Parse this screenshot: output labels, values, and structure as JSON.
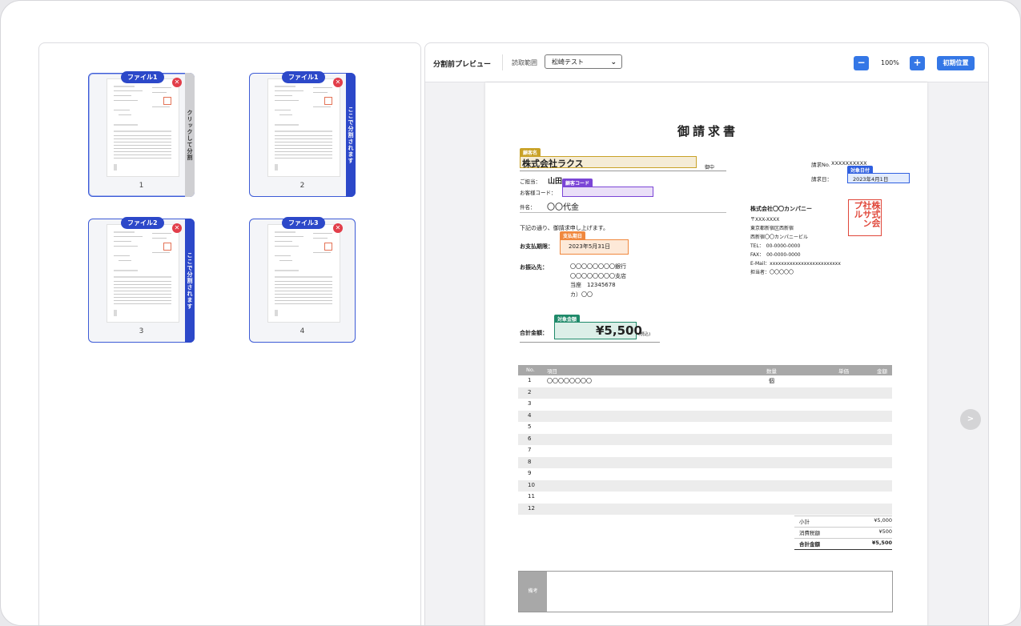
{
  "thumbnails": [
    {
      "file_label": "ファイル1",
      "page": "1",
      "side_text": "クリックして分割",
      "side_style": "gray",
      "selected": true
    },
    {
      "file_label": "ファイル1",
      "page": "2",
      "side_text": "ここで分割されます",
      "side_style": "blue",
      "selected": false
    },
    {
      "file_label": "ファイル2",
      "page": "3",
      "side_text": "ここで分割されます",
      "side_style": "blue",
      "selected": false
    },
    {
      "file_label": "ファイル3",
      "page": "4",
      "side_text": "",
      "side_style": "none",
      "selected": false
    }
  ],
  "toolbar": {
    "title": "分割前プレビュー",
    "range_label": "読取範囲",
    "range_value": "松崎テスト",
    "zoom_out": "−",
    "zoom_level": "100%",
    "zoom_in": "+",
    "reset_label": "初期位置"
  },
  "invoice": {
    "title": "御請求書",
    "customer_tag": "顧客名",
    "customer_name": "株式会社ラクス",
    "honorific": "御中",
    "contact_label": "ご担当：",
    "contact_name": "山田",
    "customer_code_tag": "顧客コード",
    "customer_code_label": "お客様コード：",
    "subject_label": "件名：",
    "subject_value": "〇〇代金",
    "invoice_no_label": "請求No.",
    "invoice_no_value": "XXXXXXXXXX",
    "date_tag": "対象日付",
    "date_label": "請求日：",
    "date_value": "2023年4月1日",
    "intro_text": "下記の通り、御請求申し上げます。",
    "due_tag": "支払期日",
    "due_label": "お支払期限：",
    "due_value": "2023年5月31日",
    "bank_label": "お振込先：",
    "bank_lines": [
      "〇〇〇〇〇〇〇〇銀行",
      "〇〇〇〇〇〇〇〇支店",
      "当座　12345678",
      "カ）〇〇"
    ],
    "amount_tag": "対象金額",
    "total_label": "合計金額：",
    "total_value": "¥5,500",
    "tax_note": "(税込)",
    "issuer_company": "株式会社〇〇カンパニー",
    "issuer_lines": [
      "〒XXX-XXXX",
      "東京都新宿区西新宿",
      "西新宿〇〇カンパニービル",
      "TEL：　00-0000-0000",
      "FAX：　00-0000-0000",
      "E-Mail：xxxxxxxxxxxxxxxxxxxxxxxxx",
      "担当者：〇〇〇〇〇"
    ],
    "stamp_text": "株式会社サンプル",
    "table_headers": [
      "No.",
      "項目",
      "数量",
      "単価",
      "金額"
    ],
    "rows": [
      {
        "no": "1",
        "item": "〇〇〇〇〇〇〇〇",
        "unit": "個"
      },
      {
        "no": "2",
        "item": "",
        "unit": ""
      },
      {
        "no": "3",
        "item": "",
        "unit": ""
      },
      {
        "no": "4",
        "item": "",
        "unit": ""
      },
      {
        "no": "5",
        "item": "",
        "unit": ""
      },
      {
        "no": "6",
        "item": "",
        "unit": ""
      },
      {
        "no": "7",
        "item": "",
        "unit": ""
      },
      {
        "no": "8",
        "item": "",
        "unit": ""
      },
      {
        "no": "9",
        "item": "",
        "unit": ""
      },
      {
        "no": "10",
        "item": "",
        "unit": ""
      },
      {
        "no": "11",
        "item": "",
        "unit": ""
      },
      {
        "no": "12",
        "item": "",
        "unit": ""
      }
    ],
    "subtotal_label": "小計",
    "subtotal_value": "¥5,000",
    "tax_label": "消費税額",
    "tax_value": "¥500",
    "grand_label": "合計金額",
    "grand_value": "¥5,500",
    "remarks_label": "備考"
  },
  "next_button": ">",
  "colors": {
    "accent_blue": "#3477e6",
    "file_pill": "#2c48c9",
    "delete_red": "#e23e4a",
    "customer_tag": "#c9a227",
    "code_tag": "#7b45d6",
    "due_tag": "#f0883e",
    "date_tag": "#2f5fe0",
    "amount_tag": "#1f8a6a",
    "stamp_red": "#e0473a"
  }
}
